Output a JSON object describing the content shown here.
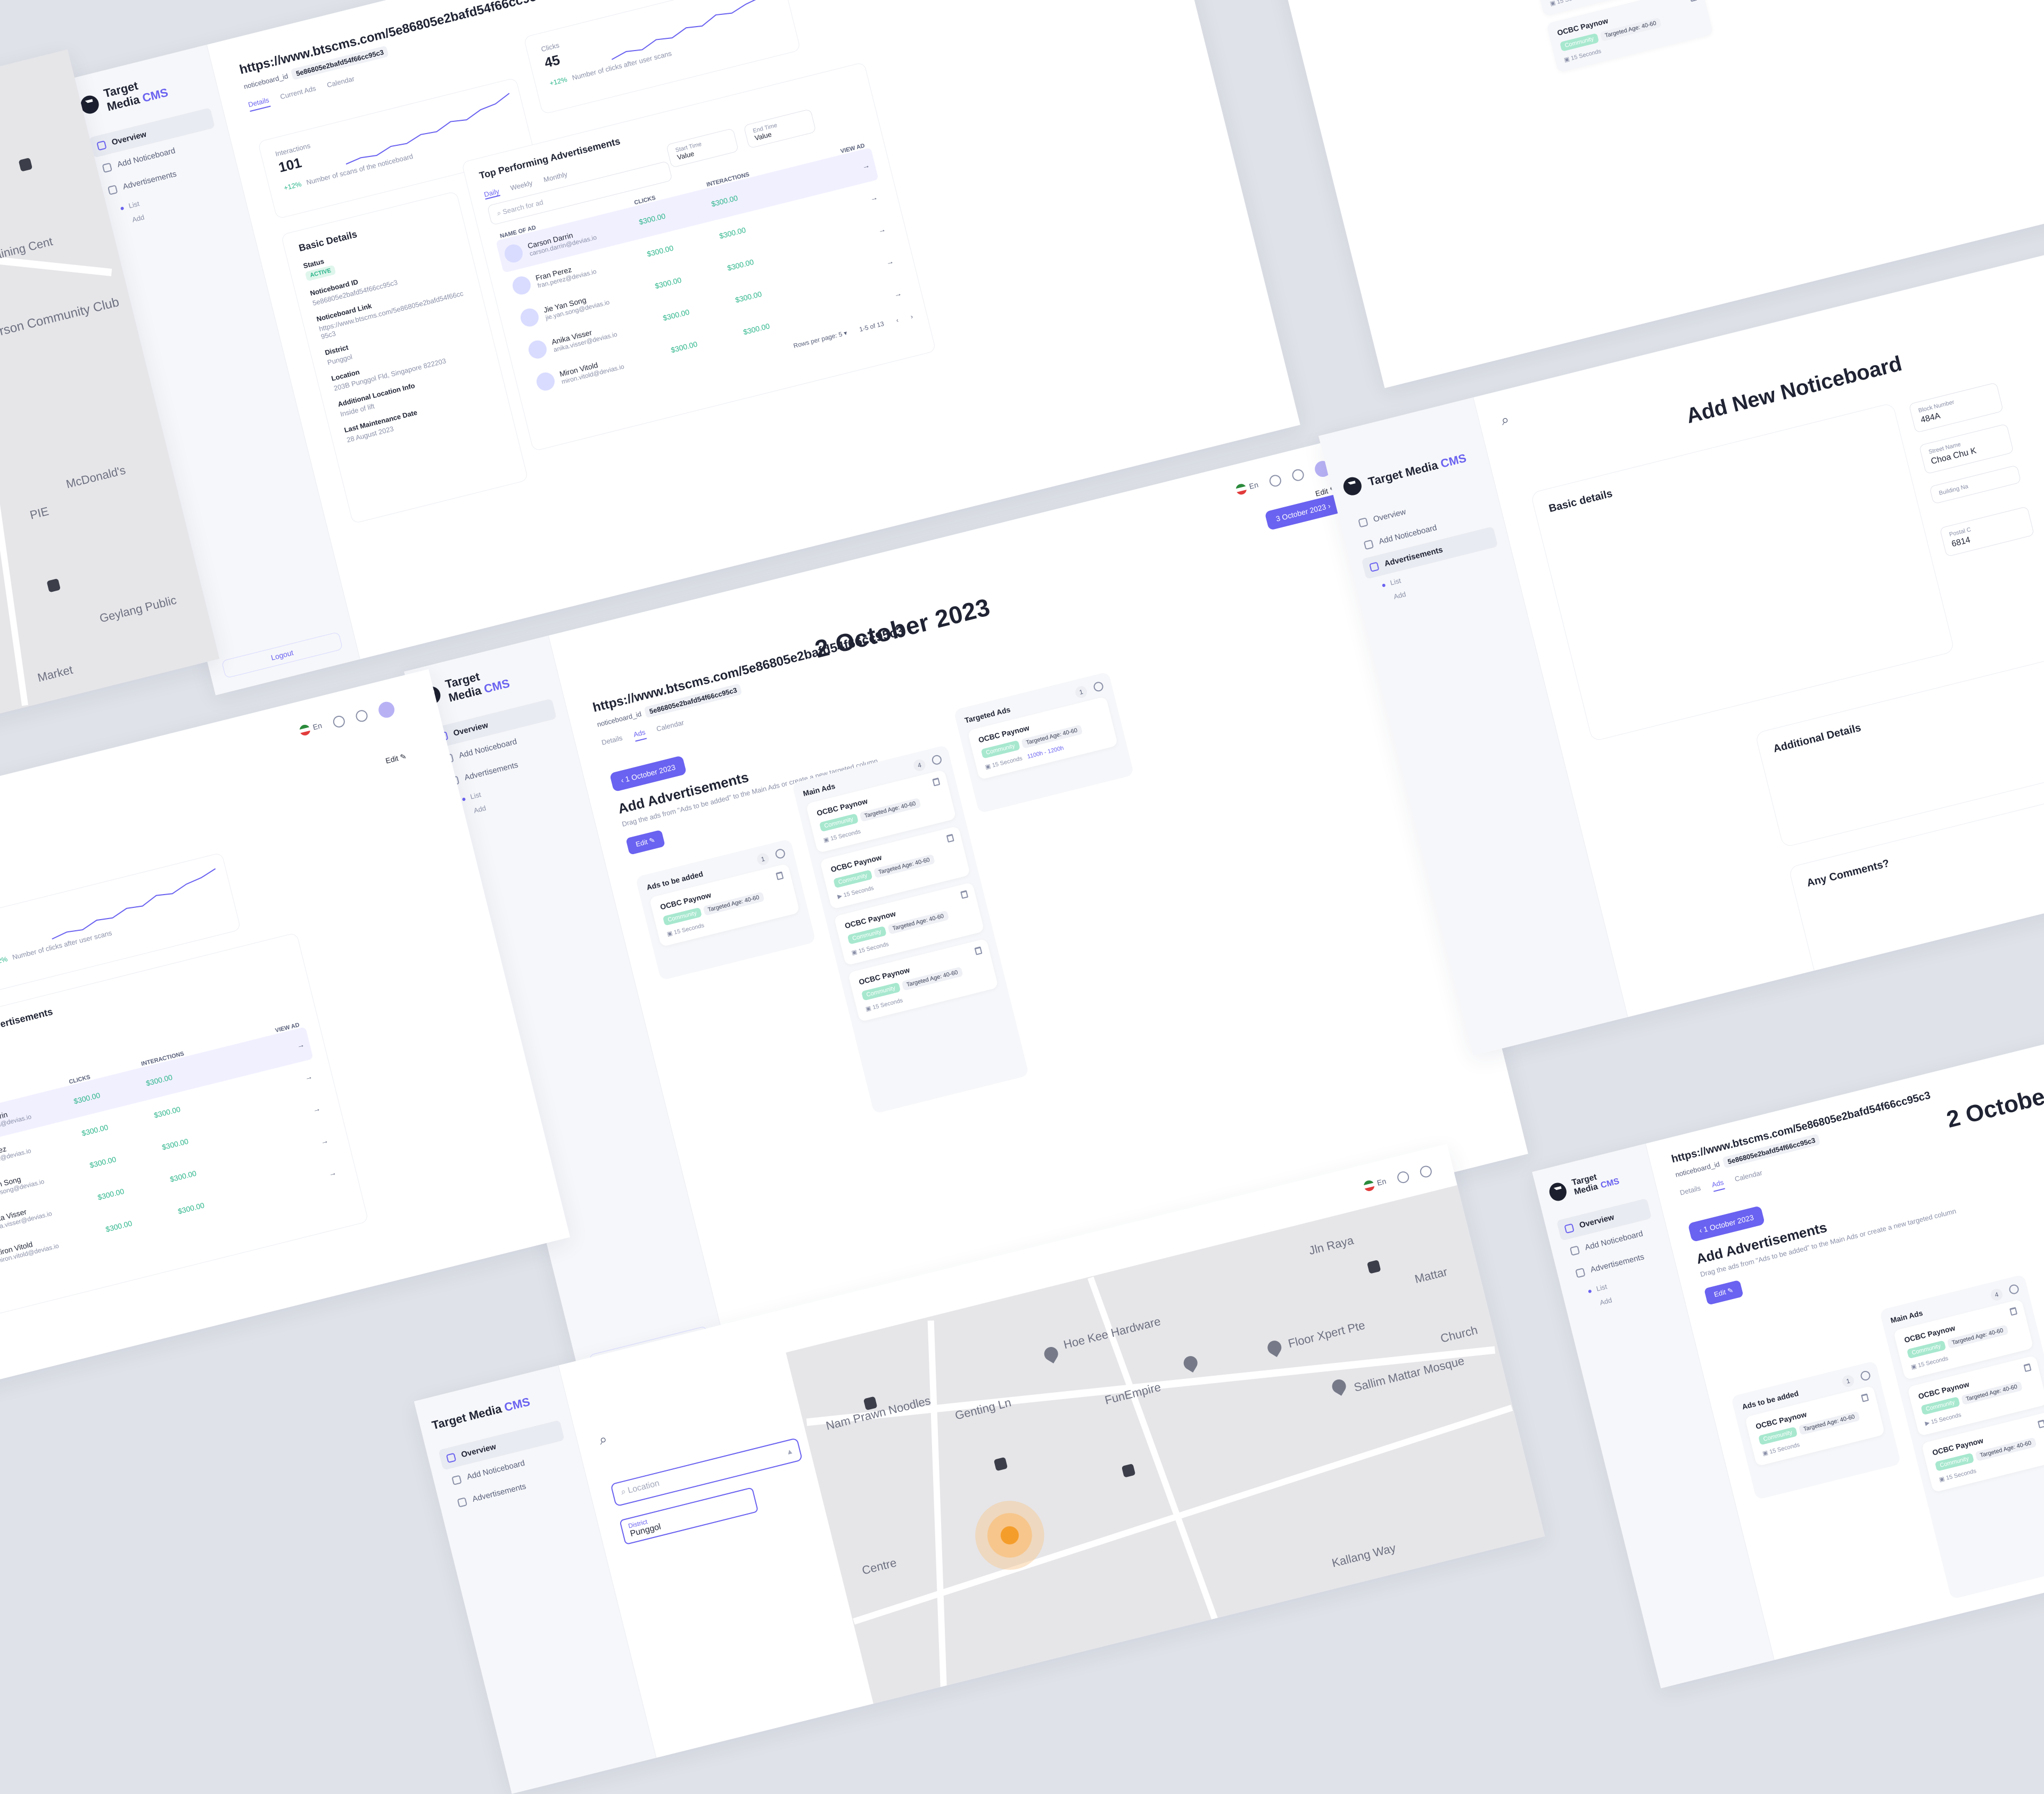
{
  "brand": {
    "name": "Target Media",
    "suffix": "CMS"
  },
  "nav": {
    "overview": "Overview",
    "add_noticeboard": "Add Noticeboard",
    "advertisements": "Advertisements",
    "list": "List",
    "add": "Add",
    "logout": "Logout"
  },
  "topbar": {
    "language": "En",
    "edit": "Edit"
  },
  "noticeboard": {
    "url": "https://www.btscms.com/5e86805e2bafd54f66cc95c3",
    "id_label": "noticeboard_id",
    "id_value": "5e86805e2bafd54f66cc95c3",
    "tabs": [
      "Details",
      "Ads",
      "Calendar"
    ],
    "tabs_details_view": [
      "Details",
      "Current Ads",
      "Calendar"
    ]
  },
  "calendar": {
    "current_date": "2 October 2023",
    "next_date": "3 October 2023",
    "prev_date": "1 October 2023"
  },
  "ads_board": {
    "title": "Add Advertisements",
    "hint": "Drag the ads from \"Ads to be added\" to the Main Ads or create a new targeted column",
    "edit_label": "Edit",
    "columns": [
      {
        "title": "Ads to be added",
        "count": "1"
      },
      {
        "title": "Main Ads",
        "count": "4"
      },
      {
        "title": "Targeted Ads",
        "count": "1"
      }
    ],
    "card": {
      "name": "OCBC Paynow",
      "status_tag": "Community",
      "age_tag": "Targeted Age: 40-60",
      "duration": "15 Seconds",
      "time_range": "1100h - 1200h"
    }
  },
  "stats": {
    "interactions_label": "Interactions",
    "interactions_value": "101",
    "interactions_foot": "Number of scans of the noticeboard",
    "clicks_label": "Clicks",
    "clicks_value": "45",
    "clicks_foot": "Number of clicks after user scans",
    "change": "+12%"
  },
  "basic_details": {
    "title": "Basic Details",
    "status_label": "Status",
    "status_value": "ACTIVE",
    "id_label": "Noticeboard ID",
    "id_value": "5e86805e2bafd54f66cc95c3",
    "link_label": "Noticeboard Link",
    "link_value": "https://www.btscms.com/5e86805e2bafd54f66cc95c3",
    "district_label": "District",
    "district_value": "Punggol",
    "location_label": "Location",
    "location_value": "203B Punggol Fld, Singapore 822203",
    "extra_label": "Additional Location Info",
    "extra_value": "Inside of lift",
    "maint_label": "Last Maintenance Date",
    "maint_value": "28 August 2023"
  },
  "top_ads": {
    "title": "Top Performing Advertisements",
    "periods": [
      "Daily",
      "Weekly",
      "Monthly"
    ],
    "search_placeholder": "Search for ad",
    "start_label": "Start Time",
    "end_label": "End Time",
    "select_value": "Value",
    "headers": [
      "Name of Ad",
      "Clicks",
      "Interactions",
      "View Ad"
    ],
    "rows": [
      {
        "name": "Carson Darrin",
        "email": "carson.darrin@devias.io",
        "clicks": "$300.00",
        "interactions": "$300.00"
      },
      {
        "name": "Fran Perez",
        "email": "fran.perez@devias.io",
        "clicks": "$300.00",
        "interactions": "$300.00"
      },
      {
        "name": "Jie Yan Song",
        "email": "jie.yan.song@devias.io",
        "clicks": "$300.00",
        "interactions": "$300.00"
      },
      {
        "name": "Anika Visser",
        "email": "anika.visser@devias.io",
        "clicks": "$300.00",
        "interactions": "$300.00"
      },
      {
        "name": "Miron Vitold",
        "email": "miron.vitold@devias.io",
        "clicks": "$300.00",
        "interactions": "$300.00"
      }
    ],
    "rows_per_page_label": "Rows per page:",
    "rows_per_page": "5",
    "range": "1-5 of 13"
  },
  "add_form": {
    "title": "Add New Noticeboard",
    "basic": "Basic details",
    "additional": "Additional Details",
    "comments": "Any Comments?",
    "block_label": "Block Number",
    "block_value": "484A",
    "street_label": "Street Name",
    "street_value": "Choa Chu K",
    "building_label": "Building Na",
    "postal_label": "Postal C",
    "postal_value": "6814"
  },
  "map": {
    "labels": [
      "Hoe Kee Hardware",
      "FunEmpire",
      "Floor Xpert Pte",
      "Jln Raya",
      "Sallim Mattar Mosque",
      "Genting Ln",
      "Nam Prawn Noodles",
      "Kallang Way",
      "Mattar",
      "Church",
      "Centre"
    ],
    "labels_left": [
      "Lion City Sail Training Cent",
      "MacPherson Community Club",
      "McDonald's",
      "Geylang Public",
      "PIE",
      "Market"
    ],
    "location_placeholder": "Location",
    "district_label": "District",
    "district_value": "Punggol"
  },
  "colors": {
    "accent": "#6a62f0",
    "positive": "#2bb58a",
    "background": "#dfe2e8"
  }
}
